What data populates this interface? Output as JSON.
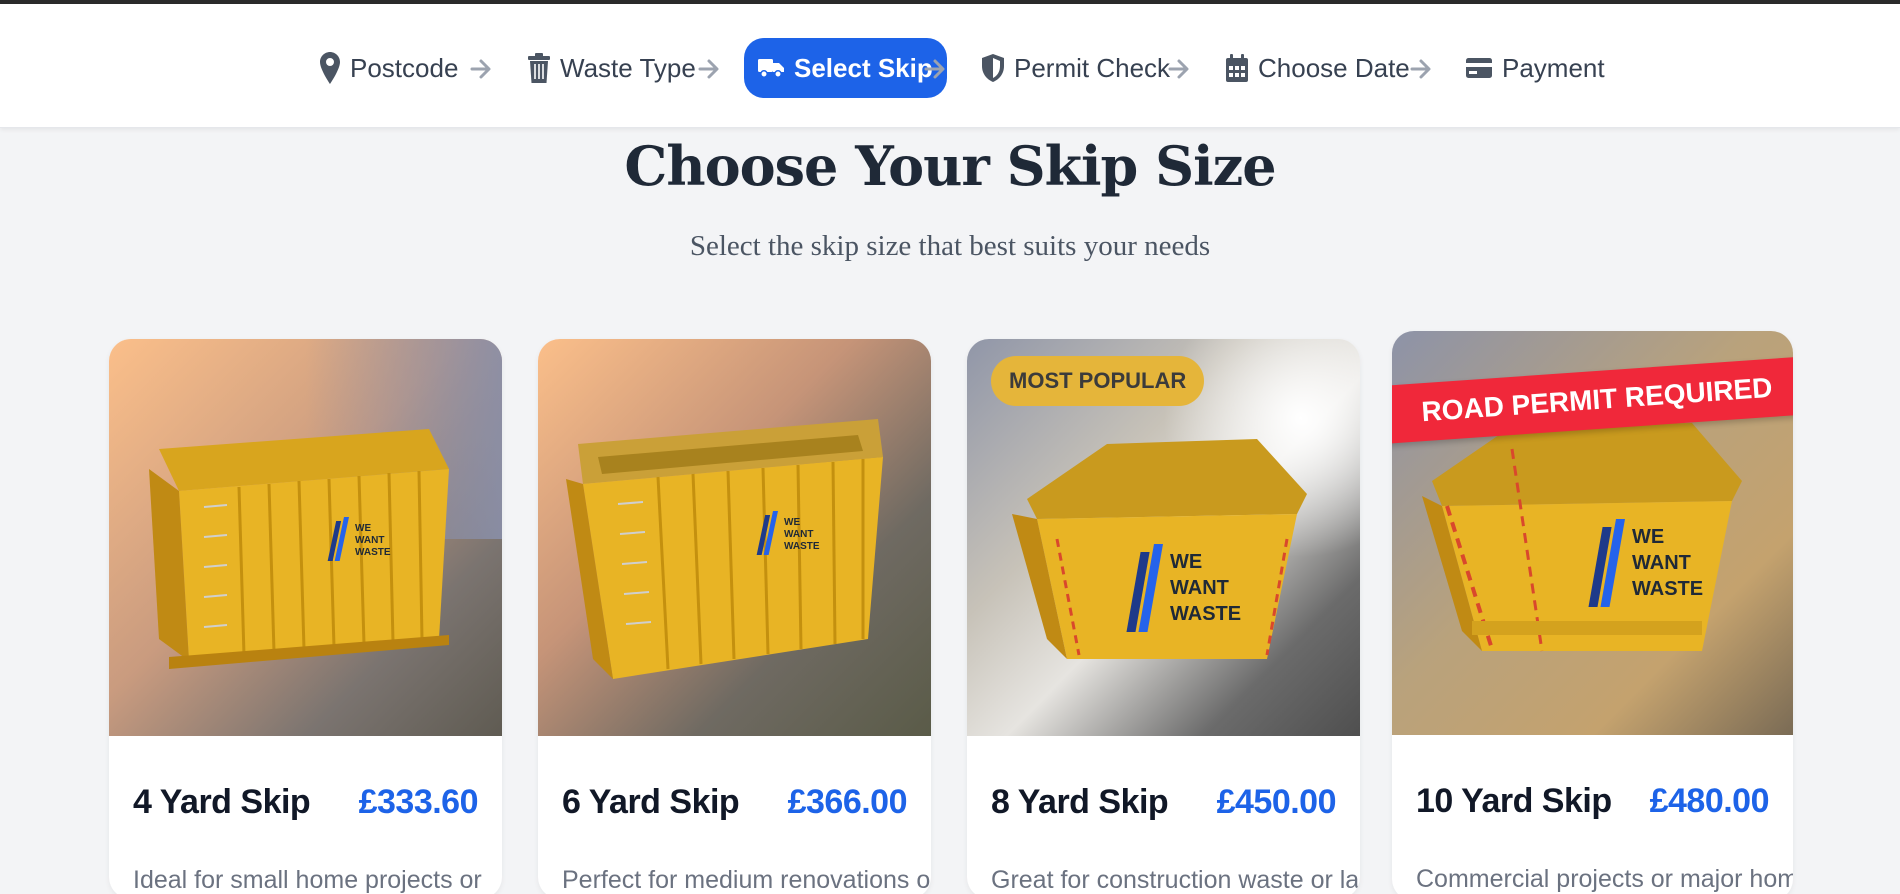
{
  "stepper": {
    "steps": [
      {
        "label": "Postcode",
        "icon": "map-pin-icon"
      },
      {
        "label": "Waste Type",
        "icon": "trash-icon"
      },
      {
        "label": "Select Skip",
        "icon": "truck-icon",
        "active": true
      },
      {
        "label": "Permit Check",
        "icon": "shield-icon"
      },
      {
        "label": "Choose Date",
        "icon": "calendar-icon"
      },
      {
        "label": "Payment",
        "icon": "credit-card-icon"
      }
    ]
  },
  "page": {
    "title": "Choose Your Skip Size",
    "subtitle": "Select the skip size that best suits your needs"
  },
  "cards": [
    {
      "name": "4 Yard Skip",
      "price": "£333.60",
      "description": "Ideal for small home projects or"
    },
    {
      "name": "6 Yard Skip",
      "price": "£366.00",
      "description": "Perfect for medium renovations or"
    },
    {
      "name": "8 Yard Skip",
      "price": "£450.00",
      "description": "Great for construction waste or large",
      "badge": "MOST POPULAR"
    },
    {
      "name": "10 Yard Skip",
      "price": "£480.00",
      "description": "Commercial projects or major home",
      "ribbon": "ROAD PERMIT REQUIRED"
    }
  ],
  "brand": {
    "logo_lines": [
      "WE",
      "WANT",
      "WASTE"
    ]
  },
  "colors": {
    "accent": "#1d63e8",
    "skip_yellow": "#e8b425",
    "popular_badge": "#e5b53a",
    "permit_ribbon": "#f0283a"
  }
}
